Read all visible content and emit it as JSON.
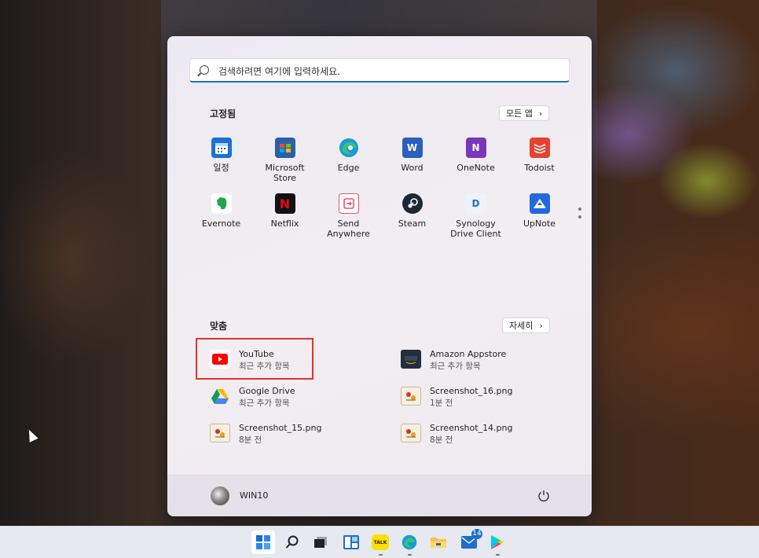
{
  "search": {
    "placeholder": "검색하려면 여기에 입력하세요."
  },
  "pinned": {
    "title": "고정됨",
    "all_apps_label": "모든 앱",
    "apps": [
      {
        "label": "일정",
        "icon": "calendar-icon",
        "color": "#1d6fd6"
      },
      {
        "label": "Microsoft Store",
        "icon": "store-icon",
        "color": "#2b5faa"
      },
      {
        "label": "Edge",
        "icon": "edge-icon",
        "color": "#1a9bd7"
      },
      {
        "label": "Word",
        "icon": "word-icon",
        "color": "#2b5fbd"
      },
      {
        "label": "OneNote",
        "icon": "onenote-icon",
        "color": "#7a38b8"
      },
      {
        "label": "Todoist",
        "icon": "todoist-icon",
        "color": "#e44332"
      },
      {
        "label": "Evernote",
        "icon": "evernote-icon",
        "color": "#1fa74d"
      },
      {
        "label": "Netflix",
        "icon": "netflix-icon",
        "color": "#111111"
      },
      {
        "label": "Send Anywhere",
        "icon": "send-anywhere-icon",
        "color": "#f04e6a"
      },
      {
        "label": "Steam",
        "icon": "steam-icon",
        "color": "#1b2838"
      },
      {
        "label": "Synology Drive Client",
        "icon": "synology-drive-icon",
        "color": "#1c6fd0"
      },
      {
        "label": "UpNote",
        "icon": "upnote-icon",
        "color": "#2268e0"
      }
    ]
  },
  "recommended": {
    "title": "맞춤",
    "more_label": "자세히",
    "items": [
      {
        "name": "YouTube",
        "sub": "최근 추가 항목",
        "icon": "youtube-icon"
      },
      {
        "name": "Amazon Appstore",
        "sub": "최근 추가 항목",
        "icon": "amazon-appstore-icon"
      },
      {
        "name": "Google Drive",
        "sub": "최근 추가 항목",
        "icon": "google-drive-icon"
      },
      {
        "name": "Screenshot_16.png",
        "sub": "1분 전",
        "icon": "image-file-icon"
      },
      {
        "name": "Screenshot_15.png",
        "sub": "8분 전",
        "icon": "image-file-icon"
      },
      {
        "name": "Screenshot_14.png",
        "sub": "8분 전",
        "icon": "image-file-icon"
      }
    ]
  },
  "user": {
    "name": "WIN10"
  },
  "taskbar": {
    "mail_badge": "14",
    "kakao_label": "TALK"
  }
}
